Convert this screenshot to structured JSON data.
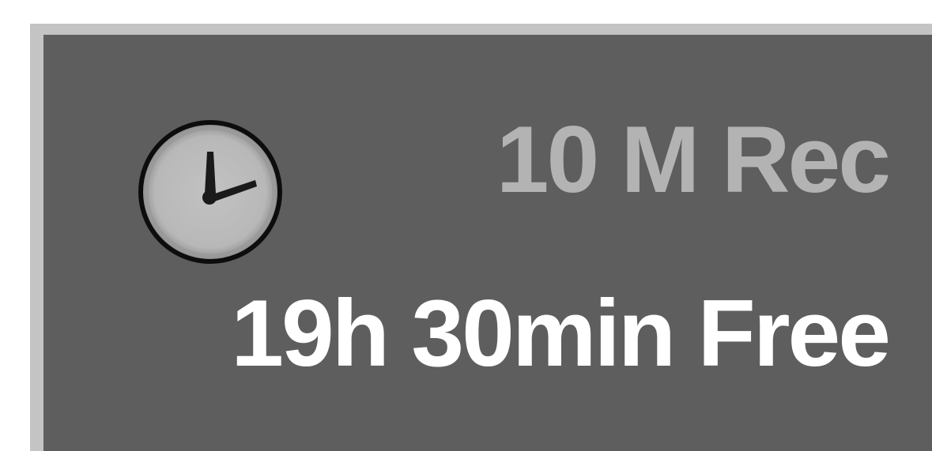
{
  "osd": {
    "rec_mode": "10 M Rec",
    "free_time": "19h 30min Free",
    "icon": "clock-icon"
  },
  "colors": {
    "panel_background": "#5e5e5e",
    "panel_border": "#c4c4c4",
    "rec_text": "#b3b3b3",
    "free_text": "#ffffff"
  }
}
